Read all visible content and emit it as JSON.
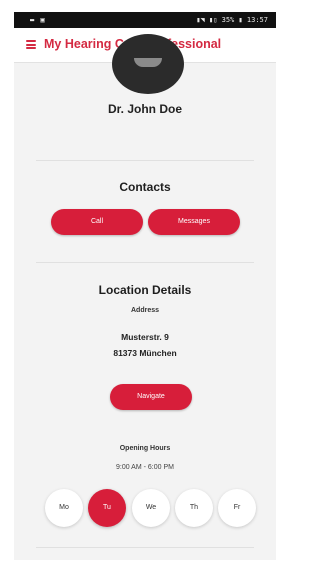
{
  "status_bar": {
    "left": "▬ ▣",
    "right": "▮◥ ▮▯ 35% ▮ 13:57"
  },
  "app_bar": {
    "title": "My Hearing Care Professional",
    "menu_icon": "hamburger-menu-icon"
  },
  "profile": {
    "name": "Dr. John Doe"
  },
  "contacts": {
    "title": "Contacts",
    "call_label": "Call",
    "messages_label": "Messages"
  },
  "location": {
    "title": "Location Details",
    "address_label": "Address",
    "street": "Musterstr. 9",
    "city": "81373 München",
    "navigate_label": "Navigate",
    "opening_hours_label": "Opening Hours",
    "hours": "9:00 AM - 6:00 PM"
  },
  "days": [
    {
      "label": "Mo",
      "active": false
    },
    {
      "label": "Tu",
      "active": true
    },
    {
      "label": "We",
      "active": false
    },
    {
      "label": "Th",
      "active": false
    },
    {
      "label": "Fr",
      "active": false
    }
  ],
  "colors": {
    "accent": "#d71e3a",
    "title_red": "#d42a42",
    "background": "#f3f3f3"
  }
}
